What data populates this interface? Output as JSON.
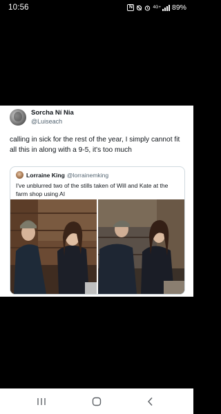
{
  "status_bar": {
    "time": "10:56",
    "battery": "89%",
    "network": "4G+"
  },
  "tweet": {
    "author_name": "Sorcha Ní Nia",
    "author_handle": "@Luiseach",
    "text": "calling in sick for the rest of the year, I simply cannot fit all this in along with a 9-5, it's too much",
    "quote": {
      "author_name": "Lorraine King",
      "author_handle": "@lorrainemking",
      "text": "I've unblurred two of the stills taken of Will and Kate at the farm shop using AI"
    }
  },
  "nav_bar": {
    "icons": [
      "recent-apps-icon",
      "home-icon",
      "back-icon"
    ]
  },
  "colors": {
    "background": "#000000",
    "card": "#ffffff",
    "text_primary": "#0f1419",
    "text_secondary": "#536471",
    "quote_border": "#cfd9de"
  }
}
